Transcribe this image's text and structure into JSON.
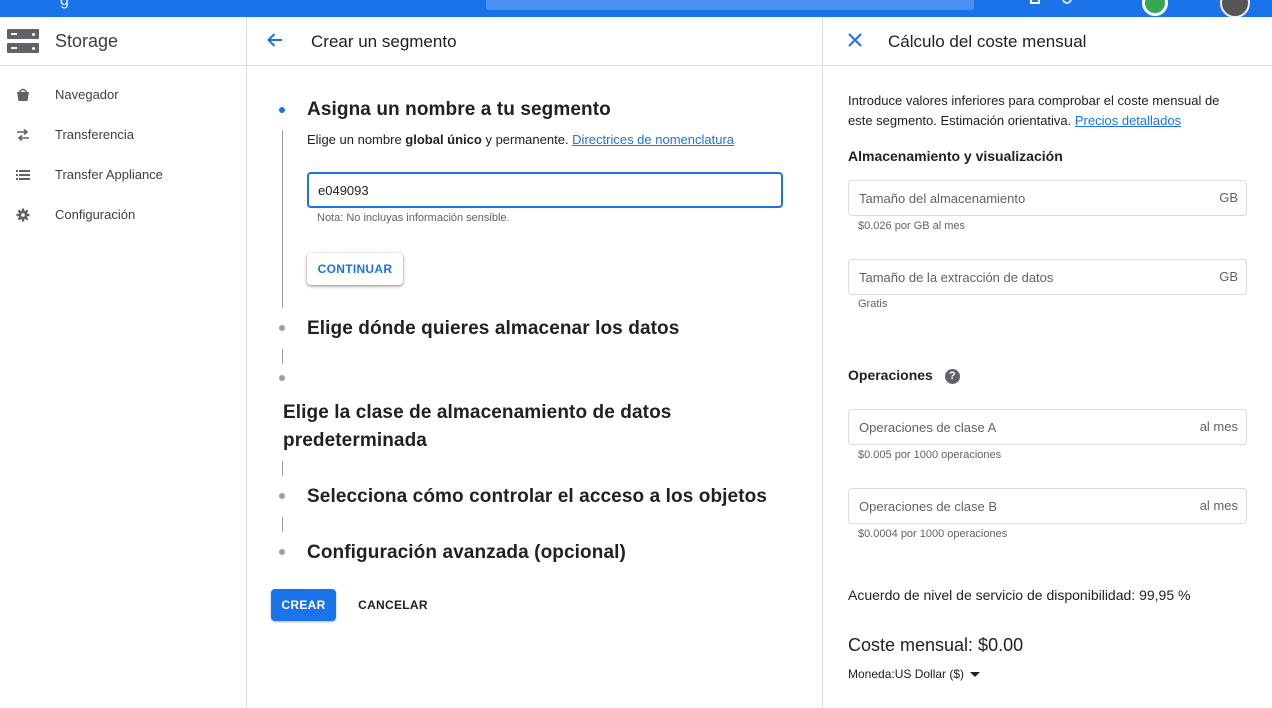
{
  "topbar": {
    "title_fragment": "g"
  },
  "sidebar": {
    "title": "Storage",
    "items": [
      {
        "label": "Navegador",
        "icon": "bucket-icon"
      },
      {
        "label": "Transferencia",
        "icon": "transfer-arrows-icon"
      },
      {
        "label": "Transfer Appliance",
        "icon": "list-icon"
      },
      {
        "label": "Configuración",
        "icon": "gear-icon"
      }
    ]
  },
  "main": {
    "title": "Crear un segmento",
    "steps": [
      {
        "title": "Asigna un nombre a tu segmento"
      },
      {
        "title": "Elige dónde quieres almacenar los datos"
      },
      {
        "title_line1": "Elige la clase de almacenamiento de datos",
        "title_line2": "predeterminada"
      },
      {
        "title": "Selecciona cómo controlar el acceso a los objetos"
      },
      {
        "title": "Configuración avanzada (opcional)"
      }
    ],
    "hint_prefix": "Elige un nombre ",
    "hint_bold": "global único",
    "hint_suffix": " y permanente. ",
    "hint_link": "Directrices de nomenclatura",
    "name_value": "e049093",
    "note": "Nota: No incluyas información sensible.",
    "continue_label": "CONTINUAR",
    "create_label": "CREAR",
    "cancel_label": "CANCELAR"
  },
  "cost_panel": {
    "title": "Cálculo del coste mensual",
    "intro": "Introduce valores inferiores para comprobar el coste mensual de este segmento. Estimación orientativa. ",
    "intro_link": "Precios detallados",
    "storage_section": "Almacenamiento y visualización",
    "storage_size_placeholder": "Tamaño del almacenamiento",
    "storage_size_unit": "GB",
    "storage_size_price": "$0.026 por GB al mes",
    "egress_placeholder": "Tamaño de la extracción de datos",
    "egress_unit": "GB",
    "egress_price": "Gratis",
    "ops_section": "Operaciones",
    "class_a_placeholder": "Operaciones de clase A",
    "class_a_unit": "al mes",
    "class_a_price": "$0.005 por 1000 operaciones",
    "class_b_placeholder": "Operaciones de clase B",
    "class_b_unit": "al mes",
    "class_b_price": "$0.0004 por 1000 operaciones",
    "sla": "Acuerdo de nivel de servicio de disponibilidad: 99,95 %",
    "monthly_cost": "Coste mensual: $0.00",
    "currency_label": "Moneda:",
    "currency_value": "US Dollar ($)"
  },
  "colors": {
    "accent": "#1a73e8",
    "text": "#202124",
    "muted": "#5f6368",
    "border": "#dadce0"
  }
}
